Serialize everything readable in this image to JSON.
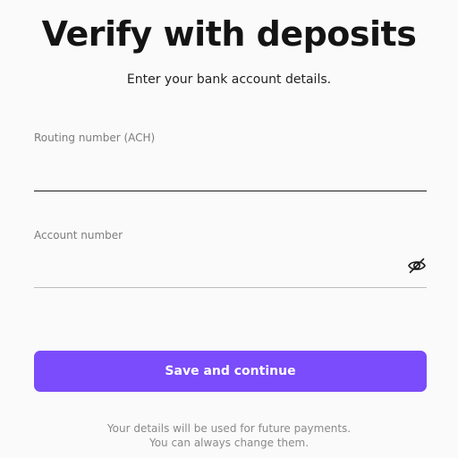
{
  "header": {
    "title": "Verify with deposits",
    "subtitle": "Enter your bank account details."
  },
  "form": {
    "routing": {
      "label": "Routing number (ACH)",
      "value": "",
      "placeholder": ""
    },
    "account": {
      "label": "Account number",
      "value": "",
      "placeholder": "",
      "visibility_icon": "eye-off-icon"
    }
  },
  "actions": {
    "save_label": "Save and continue"
  },
  "footer": {
    "line1": "Your details will be used for future payments.",
    "line2": "You can always change them."
  },
  "colors": {
    "accent": "#7a4cfb",
    "background": "#fafafa"
  }
}
